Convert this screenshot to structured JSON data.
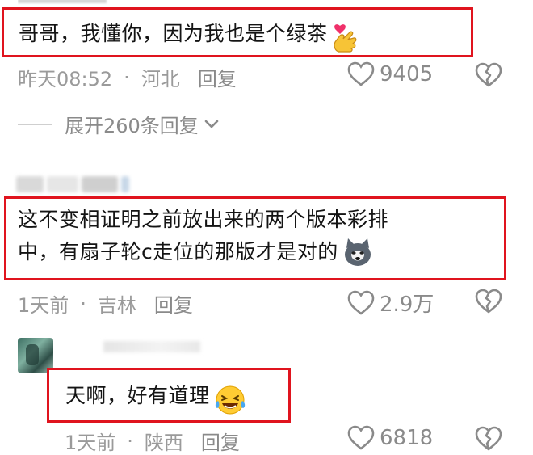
{
  "comments": [
    {
      "text": "哥哥，我懂你，因为我也是个绿茶",
      "emoji": "finger-heart-emoji",
      "time": "昨天08:52",
      "location": "河北",
      "reply_label": "回复",
      "likes": "9405"
    },
    {
      "text_line1": "这不变相证明之前放出来的两个版本彩排",
      "text_line2": "中，有扇子轮c走位的那版才是对的",
      "emoji": "husky-dog-emoji",
      "time": "1天前",
      "location": "吉林",
      "reply_label": "回复",
      "likes": "2.9万"
    },
    {
      "text": "天啊，好有道理",
      "emoji": "laughing-tears-emoji",
      "time": "1天前",
      "location": "陕西",
      "reply_label": "回复",
      "likes": "6818"
    }
  ],
  "expand_replies": "展开260条回复",
  "separator": "·",
  "colors": {
    "highlight_border": "#e0141e",
    "meta_text": "#9a9a9a"
  }
}
